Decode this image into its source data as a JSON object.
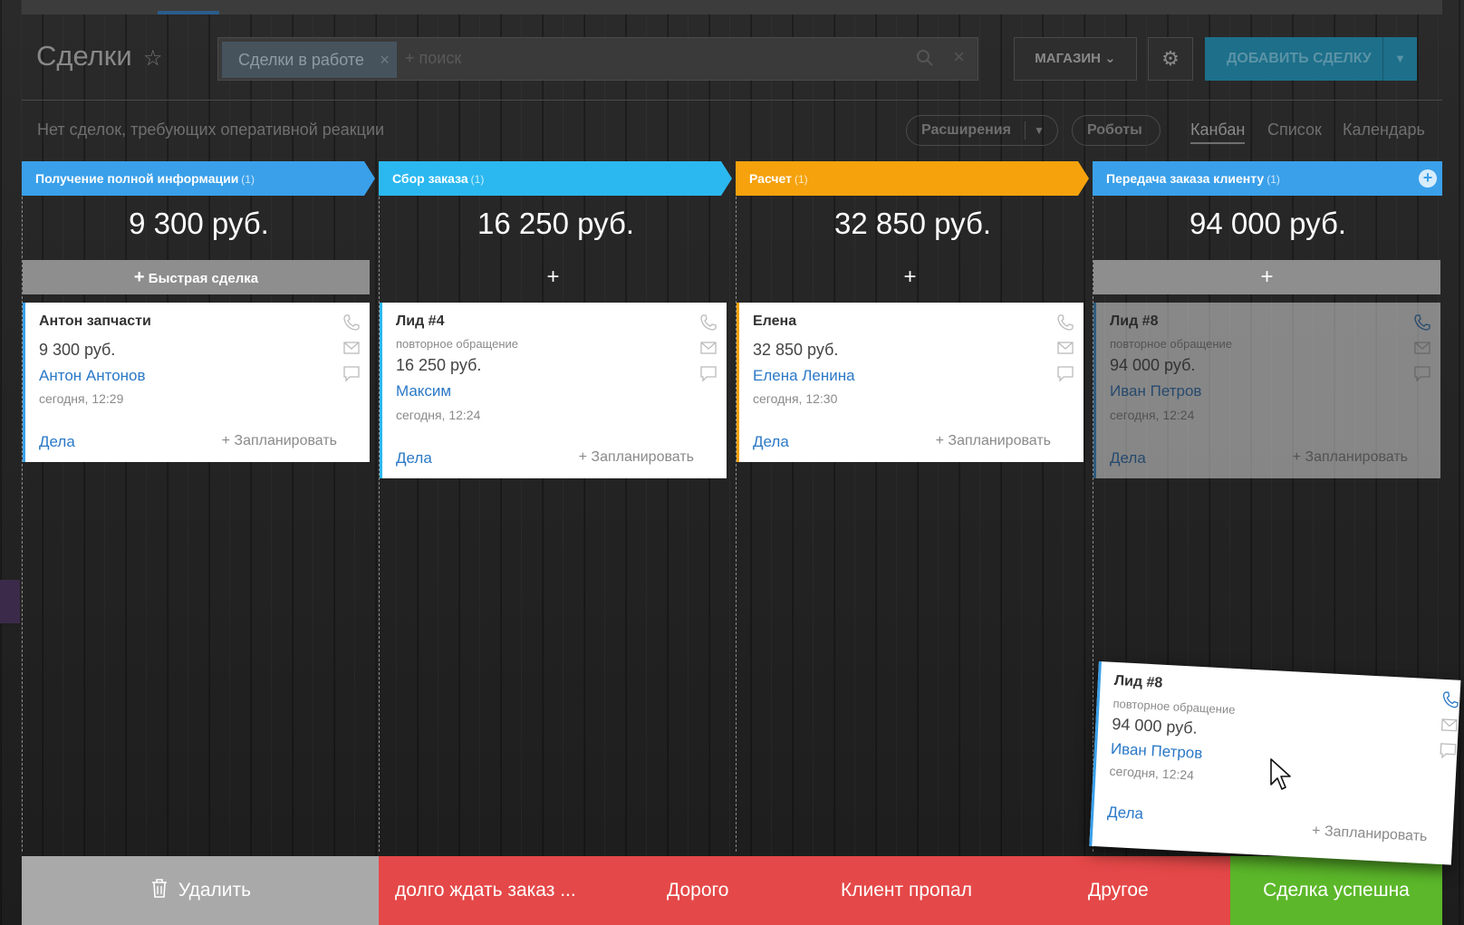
{
  "header": {
    "title": "Сделки",
    "filter_chip": "Сделки в работе",
    "search_placeholder": "+ поиск",
    "shop_button": "МАГАЗИН",
    "add_button": "ДОБАВИТЬ СДЕЛКУ"
  },
  "subheader": {
    "notice": "Нет сделок, требующих оперативной реакции",
    "extensions": "Расширения",
    "robots": "Роботы",
    "views": [
      "Канбан",
      "Список",
      "Календарь"
    ]
  },
  "stages": [
    {
      "name": "Получение полной информации",
      "count": "(1)",
      "sum": "9 300 руб.",
      "color": "#3aa0ea",
      "add_label": "Быстрая сделка"
    },
    {
      "name": "Сбор заказа",
      "count": "(1)",
      "sum": "16 250 руб.",
      "color": "#2bb8f0",
      "add_label": "+"
    },
    {
      "name": "Расчет",
      "count": "(1)",
      "sum": "32 850 руб.",
      "color": "#f5a20d",
      "add_label": "+"
    },
    {
      "name": "Передача заказа клиенту",
      "count": "(1)",
      "sum": "94 000 руб.",
      "color": "#3aa0ea",
      "add_label": "+"
    }
  ],
  "cards": [
    {
      "title": "Антон запчасти",
      "amount": "9 300 руб.",
      "contact": "Антон Антонов",
      "time": "сегодня, 12:29",
      "deals": "Дела",
      "plan": "+ Запланировать"
    },
    {
      "title": "Лид #4",
      "subtitle": "повторное обращение",
      "amount": "16 250 руб.",
      "contact": "Максим",
      "time": "сегодня, 12:24",
      "deals": "Дела",
      "plan": "+ Запланировать"
    },
    {
      "title": "Елена",
      "amount": "32 850 руб.",
      "contact": "Елена Ленина",
      "time": "сегодня, 12:30",
      "deals": "Дела",
      "plan": "+ Запланировать"
    },
    {
      "title": "Лид #8",
      "subtitle": "повторное обращение",
      "amount": "94 000 руб.",
      "contact": "Иван Петров",
      "time": "сегодня, 12:24",
      "deals": "Дела",
      "plan": "+ Запланировать"
    }
  ],
  "dragged_card": {
    "title": "Лид #8",
    "subtitle": "повторное обращение",
    "amount": "94 000 руб.",
    "contact": "Иван Петров",
    "time": "сегодня, 12:24",
    "deals": "Дела",
    "plan": "+ Запланировать"
  },
  "dropzones": {
    "delete": "Удалить",
    "fail_reasons": [
      "долго ждать заказ ...",
      "Дорого",
      "Клиент пропал",
      "Другое"
    ],
    "success": "Сделка успешна"
  },
  "colors": {
    "danger": "#e54848",
    "success": "#5cb82a",
    "link": "#2a78c6"
  }
}
